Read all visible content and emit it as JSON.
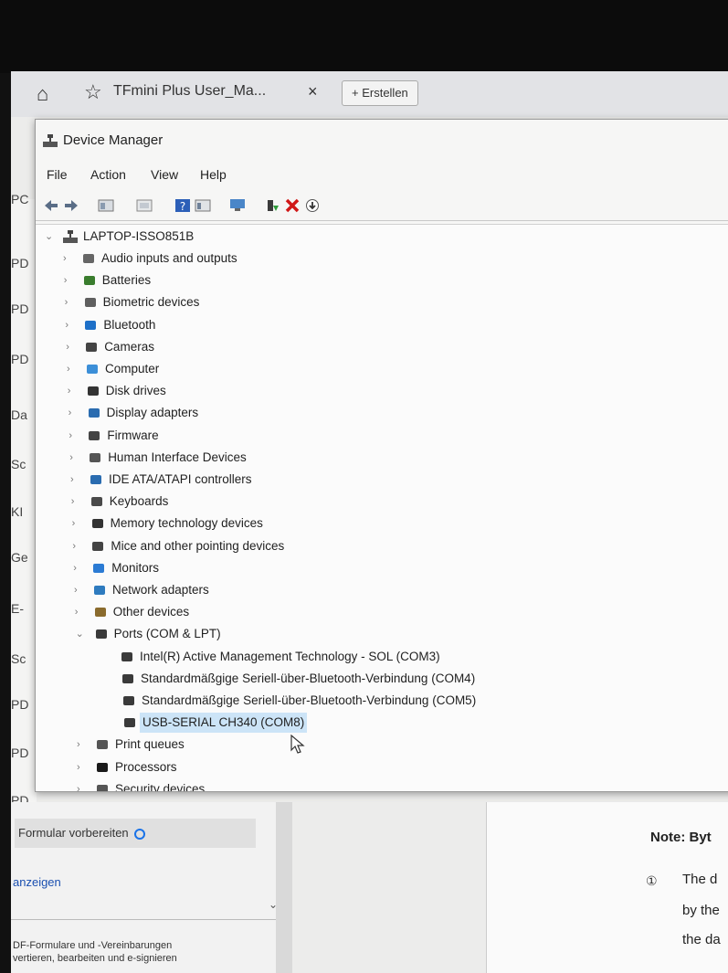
{
  "browser": {
    "tab_title": "TFmini Plus User_Ma...",
    "tab_close": "×",
    "new_tab_label": "+ Erstellen"
  },
  "left_strip": [
    "PC",
    "PD",
    "PD",
    "PD",
    "Da",
    "Sc",
    "KI",
    "Ge",
    "E-",
    "Sc",
    "PD",
    "PD",
    "PD"
  ],
  "device_manager": {
    "title": "Device Manager",
    "menu": [
      "File",
      "Action",
      "View",
      "Help"
    ],
    "computer_name": "LAPTOP-ISSO851B",
    "categories": [
      "Audio inputs and outputs",
      "Batteries",
      "Biometric devices",
      "Bluetooth",
      "Cameras",
      "Computer",
      "Disk drives",
      "Display adapters",
      "Firmware",
      "Human Interface Devices",
      "IDE ATA/ATAPI controllers",
      "Keyboards",
      "Memory technology devices",
      "Mice and other pointing devices",
      "Monitors",
      "Network adapters",
      "Other devices",
      "Ports (COM & LPT)"
    ],
    "ports": [
      "Intel(R) Active Management Technology - SOL (COM3)",
      "Standardmäßgige Seriell-über-Bluetooth-Verbindung (COM4)",
      "Standardmäßgige Seriell-über-Bluetooth-Verbindung (COM5)",
      "USB-SERIAL CH340 (COM8)"
    ],
    "after_ports": [
      "Print queues",
      "Processors",
      "Security devices"
    ]
  },
  "pdf_panel": {
    "item1": "Formular vorbereiten",
    "item2": "anzeigen",
    "desc_line1": "DF-Formulare und -Vereinbarungen",
    "desc_line2": "vertieren, bearbeiten und e-signieren"
  },
  "document": {
    "note": "Note: Byt",
    "bullet": "①",
    "line1": "The d",
    "line2": "by the",
    "line3": "the da"
  }
}
